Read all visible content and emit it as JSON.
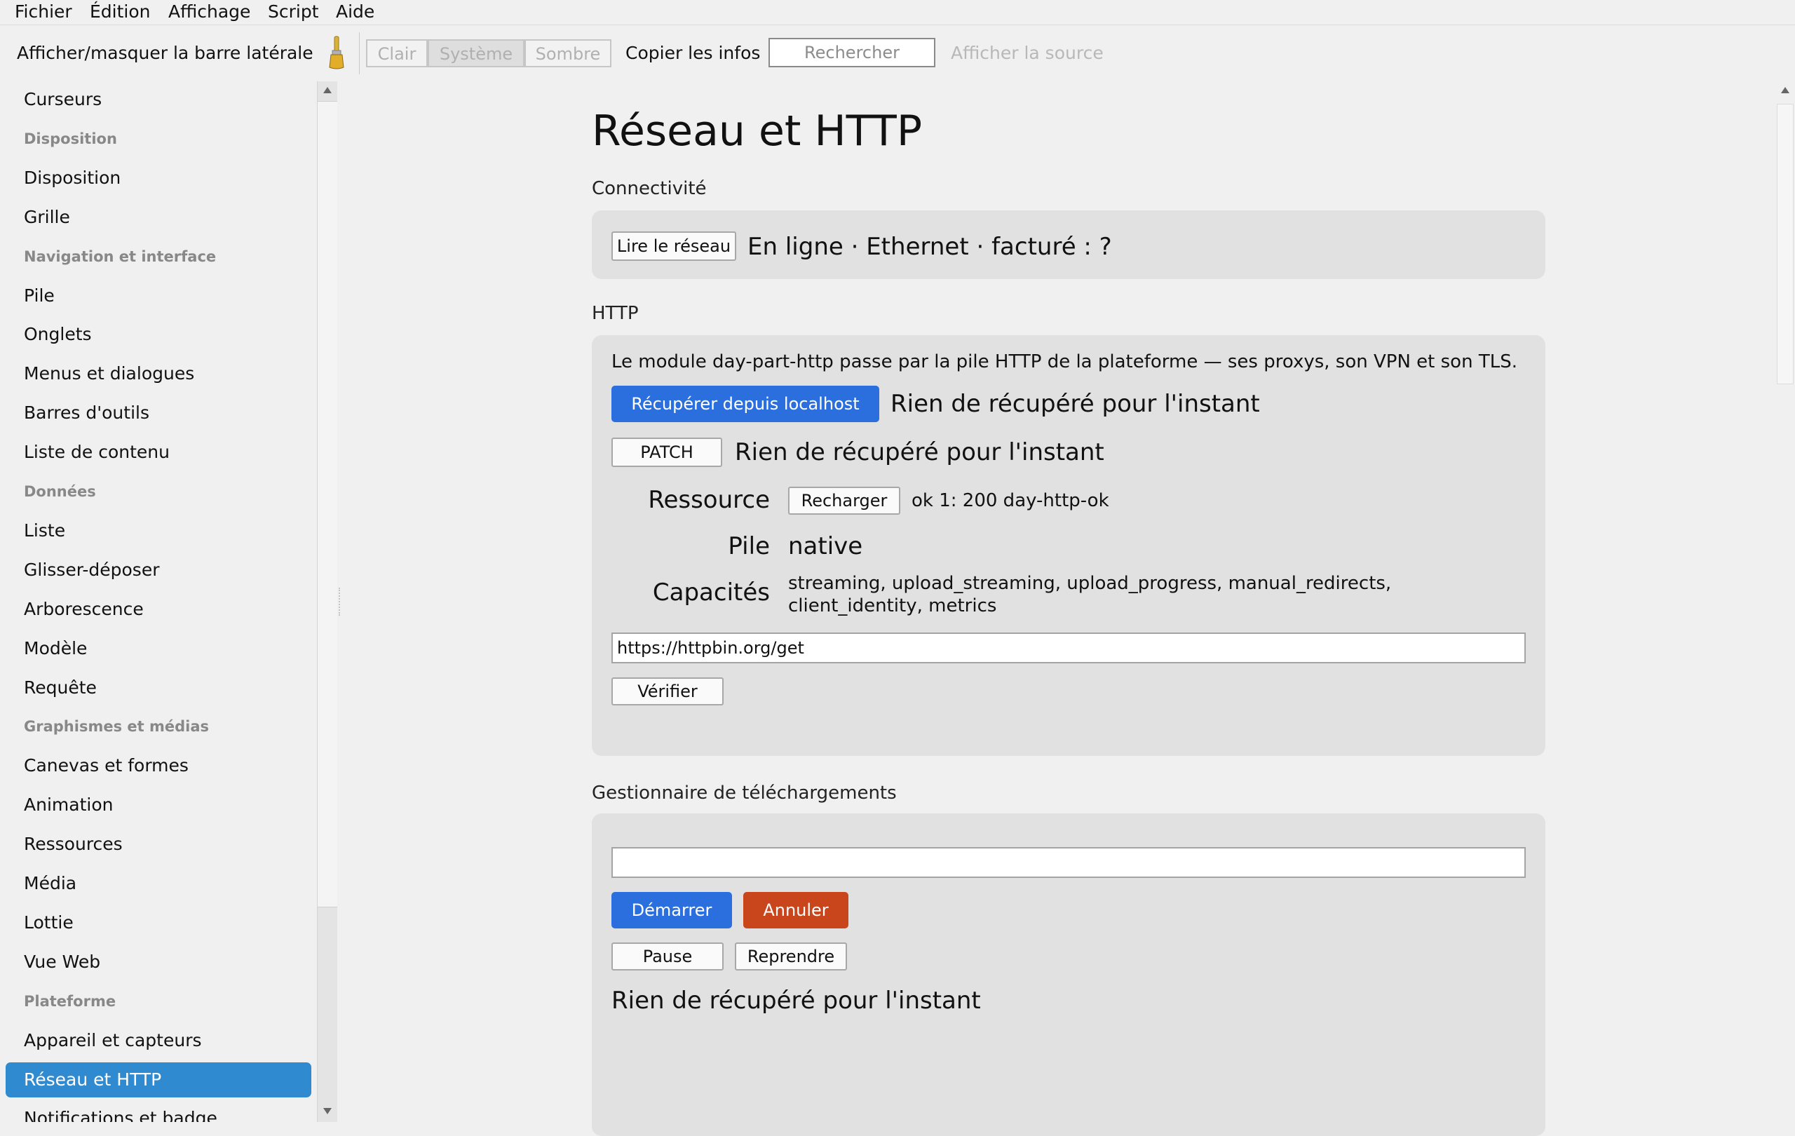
{
  "menubar": {
    "items": [
      "Fichier",
      "Édition",
      "Affichage",
      "Script",
      "Aide"
    ]
  },
  "toolbar": {
    "sidebar_toggle": "Afficher/masquer la barre latérale",
    "theme_light": "Clair",
    "theme_system": "Système",
    "theme_dark": "Sombre",
    "copy_info": "Copier les infos",
    "search_placeholder": "Rechercher",
    "view_source": "Afficher la source"
  },
  "sidebar": {
    "items": [
      {
        "label": "Curseurs",
        "type": "item"
      },
      {
        "label": "Disposition",
        "type": "header"
      },
      {
        "label": "Disposition",
        "type": "item"
      },
      {
        "label": "Grille",
        "type": "item"
      },
      {
        "label": "Navigation et interface",
        "type": "header"
      },
      {
        "label": "Pile",
        "type": "item"
      },
      {
        "label": "Onglets",
        "type": "item"
      },
      {
        "label": "Menus et dialogues",
        "type": "item"
      },
      {
        "label": "Barres d'outils",
        "type": "item"
      },
      {
        "label": "Liste de contenu",
        "type": "item"
      },
      {
        "label": "Données",
        "type": "header"
      },
      {
        "label": "Liste",
        "type": "item"
      },
      {
        "label": "Glisser-déposer",
        "type": "item"
      },
      {
        "label": "Arborescence",
        "type": "item"
      },
      {
        "label": "Modèle",
        "type": "item"
      },
      {
        "label": "Requête",
        "type": "item"
      },
      {
        "label": "Graphismes et médias",
        "type": "header"
      },
      {
        "label": "Canevas et formes",
        "type": "item"
      },
      {
        "label": "Animation",
        "type": "item"
      },
      {
        "label": "Ressources",
        "type": "item"
      },
      {
        "label": "Média",
        "type": "item"
      },
      {
        "label": "Lottie",
        "type": "item"
      },
      {
        "label": "Vue Web",
        "type": "item"
      },
      {
        "label": "Plateforme",
        "type": "header"
      },
      {
        "label": "Appareil et capteurs",
        "type": "item"
      },
      {
        "label": "Réseau et HTTP",
        "type": "item",
        "selected": true
      },
      {
        "label": "Notifications et badge",
        "type": "item"
      }
    ]
  },
  "main": {
    "title": "Réseau et HTTP",
    "connectivity": {
      "section_title": "Connectivité",
      "read_button": "Lire le réseau",
      "status": "En ligne · Ethernet · facturé : ?"
    },
    "http": {
      "section_title": "HTTP",
      "description": "Le module day-part-http passe par la pile HTTP de la plateforme — ses proxys, son VPN et son TLS.",
      "fetch_button": "Récupérer depuis localhost",
      "fetch_result": "Rien de récupéré pour l'instant",
      "patch_button": "PATCH",
      "patch_result": "Rien de récupéré pour l'instant",
      "resource_label": "Ressource",
      "reload_button": "Recharger",
      "resource_value": "ok 1: 200 day-http-ok",
      "stack_label": "Pile",
      "stack_value": "native",
      "capabilities_label": "Capacités",
      "capabilities_line1": "streaming, upload_streaming, upload_progress, manual_redirects,",
      "capabilities_line2": "client_identity, metrics",
      "url_value": "https://httpbin.org/get",
      "verify_button": "Vérifier"
    },
    "downloads": {
      "section_title": "Gestionnaire de téléchargements",
      "url_value": "",
      "start_button": "Démarrer",
      "cancel_button": "Annuler",
      "pause_button": "Pause",
      "resume_button": "Reprendre",
      "result": "Rien de récupéré pour l'instant"
    }
  },
  "colors": {
    "accent": "#2b6fdf",
    "selection": "#2f8ad0",
    "danger": "#c9461d",
    "card": "#e1e1e1",
    "window": "#f0f0f0"
  },
  "icons": {
    "theme_brush": "paint-brush-icon"
  }
}
